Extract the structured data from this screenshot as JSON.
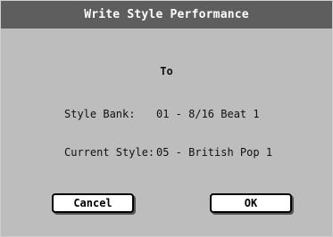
{
  "dialog": {
    "title": "Write Style Performance",
    "to_label": "To",
    "rows": [
      {
        "label": "Style Bank:",
        "value": "01 - 8/16 Beat 1"
      },
      {
        "label": "Current Style:",
        "value": "05 - British Pop 1"
      }
    ],
    "buttons": {
      "cancel": "Cancel",
      "ok": "OK"
    }
  }
}
